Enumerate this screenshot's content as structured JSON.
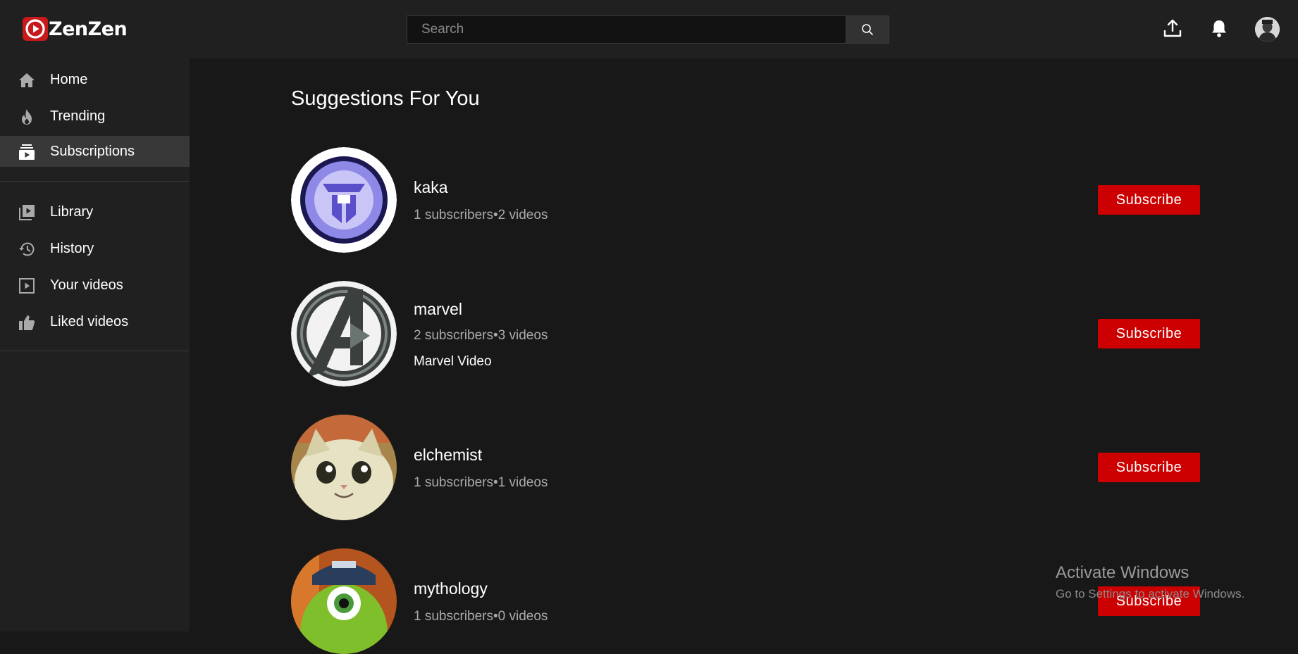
{
  "brand": {
    "name": "ZenZen",
    "accent": "#cc0000"
  },
  "search": {
    "placeholder": "Search"
  },
  "header": {
    "icons": [
      "upload-icon",
      "bell-icon",
      "search-icon"
    ]
  },
  "sidebar": {
    "items": [
      {
        "label": "Home",
        "icon": "home-icon"
      },
      {
        "label": "Trending",
        "icon": "fire-icon"
      },
      {
        "label": "Subscriptions",
        "icon": "subscriptions-icon",
        "active": true
      },
      {
        "label": "Library",
        "icon": "library-icon"
      },
      {
        "label": "History",
        "icon": "history-icon"
      },
      {
        "label": "Your videos",
        "icon": "play-square-icon"
      },
      {
        "label": "Liked videos",
        "icon": "thumbs-up-icon"
      }
    ]
  },
  "main": {
    "title": "Suggestions For You",
    "channels": [
      {
        "name": "kaka",
        "meta": "1 subscribers•2 videos",
        "description": "",
        "button": "Subscribe"
      },
      {
        "name": "marvel",
        "meta": "2 subscribers•3 videos",
        "description": "Marvel Video",
        "button": "Subscribe"
      },
      {
        "name": "elchemist",
        "meta": "1 subscribers•1 videos",
        "description": "",
        "button": "Subscribe"
      },
      {
        "name": "mythology",
        "meta": "1 subscribers•0 videos",
        "description": "",
        "button": "Subscribe"
      }
    ]
  },
  "watermark": {
    "title": "Activate Windows",
    "subtitle": "Go to Settings to activate Windows."
  }
}
